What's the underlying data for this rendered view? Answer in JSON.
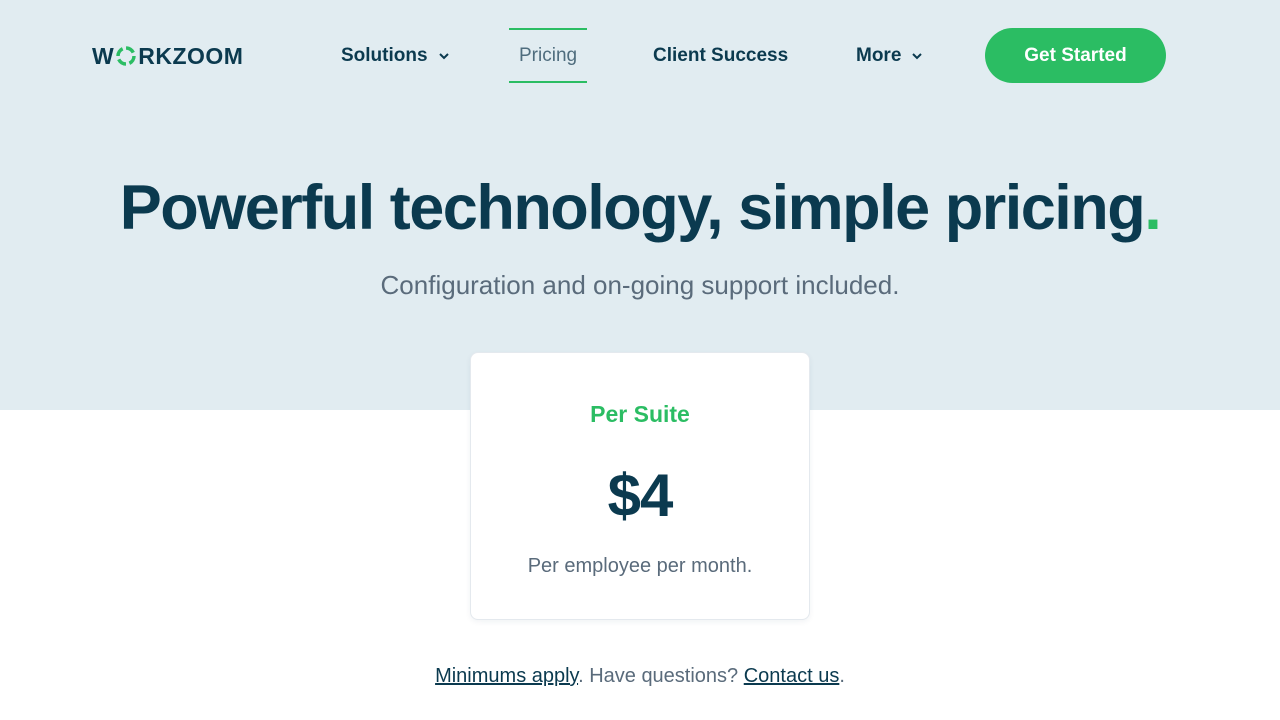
{
  "brand": {
    "logo_prefix": "W",
    "logo_suffix": "RKZOOM",
    "logo_mark_icon": "swirl-o-icon",
    "accent_color": "#2bbd63",
    "navy_color": "#0b3a4f",
    "hero_bg_color": "#e1ecf1"
  },
  "nav": {
    "items": [
      {
        "label": "Solutions",
        "has_dropdown": true
      },
      {
        "label": "Pricing",
        "active": true
      },
      {
        "label": "Client Success"
      },
      {
        "label": "More",
        "has_dropdown": true
      }
    ],
    "cta_label": "Get Started"
  },
  "hero": {
    "title": "Powerful technology, simple pricing",
    "title_dot": ".",
    "subtitle": "Configuration and on-going support included."
  },
  "pricing_card": {
    "title": "Per Suite",
    "price": "$4",
    "note": "Per employee per month."
  },
  "footer_line": {
    "link1": "Minimums apply",
    "text1": ". Have questions? ",
    "link2": "Contact us",
    "text2": "."
  }
}
